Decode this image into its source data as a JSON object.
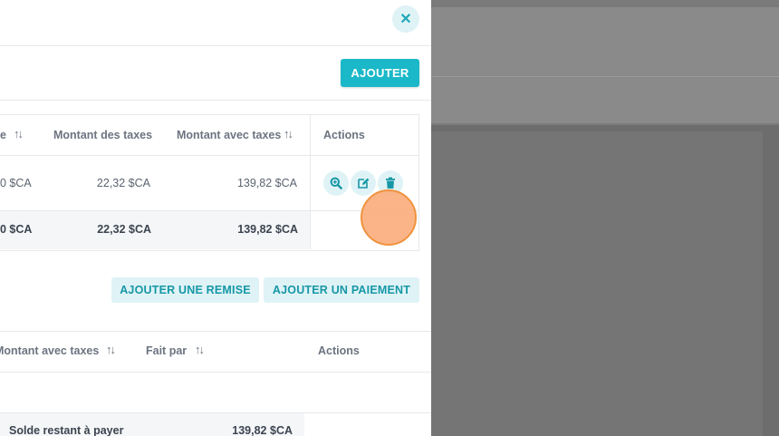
{
  "drawer": {
    "close_icon": "close-icon",
    "close_glyph": "✕",
    "add_label": "AJOUTER",
    "add_discount_label": "AJOUTER UNE REMISE",
    "add_payment_label": "AJOUTER UN PAIEMENT"
  },
  "items_table": {
    "headers": {
      "partial": "e",
      "tax_amount": "Montant des taxes",
      "amount_with_tax": "Montant avec taxes",
      "actions": "Actions"
    },
    "row": {
      "partial": "0 $CA",
      "tax_amount": "22,32 $CA",
      "amount_with_tax": "139,82 $CA",
      "actions": [
        "view-icon",
        "edit-icon",
        "delete-icon"
      ]
    },
    "total": {
      "partial": "0 $CA",
      "tax_amount": "22,32 $CA",
      "amount_with_tax": "139,82 $CA"
    }
  },
  "payments_table": {
    "headers": {
      "amount_with_tax": "Montant avec taxes",
      "done_by": "Fait par",
      "actions": "Actions"
    },
    "balance_label": "Solde restant à payer",
    "balance_value": "139,82 $CA"
  },
  "colors": {
    "accent": "#1ab8c8",
    "accent_soft": "#dff3f6",
    "cursor": "#fbaa78"
  }
}
